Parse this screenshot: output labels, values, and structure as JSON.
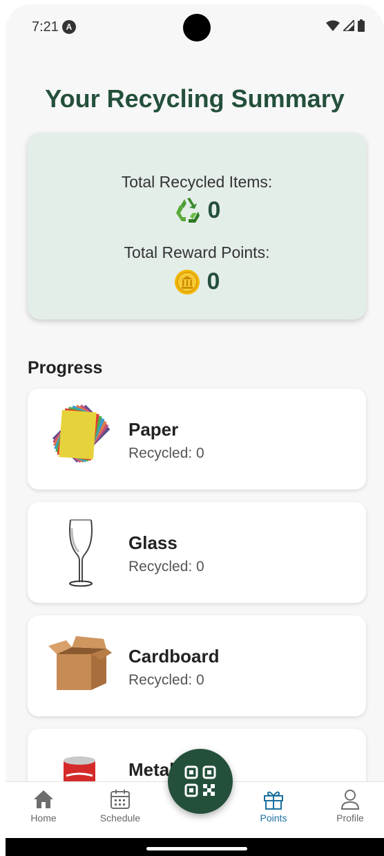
{
  "status_bar": {
    "time": "7:21",
    "notification_badge": "A"
  },
  "page": {
    "title": "Your Recycling Summary"
  },
  "summary": {
    "recycled_label": "Total Recycled Items:",
    "recycled_value": "0",
    "points_label": "Total Reward Points:",
    "points_value": "0"
  },
  "progress": {
    "title": "Progress",
    "items": [
      {
        "name": "Paper",
        "recycled": "Recycled: 0",
        "icon": "paper-stack-icon"
      },
      {
        "name": "Glass",
        "recycled": "Recycled: 0",
        "icon": "wine-glass-icon"
      },
      {
        "name": "Cardboard",
        "recycled": "Recycled: 0",
        "icon": "cardboard-box-icon"
      },
      {
        "name": "Metal",
        "icon": "soda-can-icon"
      }
    ]
  },
  "bottom_nav": {
    "items": [
      {
        "label": "Home",
        "icon": "home-icon"
      },
      {
        "label": "Schedule",
        "icon": "calendar-icon"
      },
      {
        "label": "Points",
        "icon": "gift-icon",
        "active": true
      },
      {
        "label": "Profile",
        "icon": "person-icon"
      }
    ],
    "fab_icon": "qr-code-icon"
  },
  "colors": {
    "brand_green": "#24503b",
    "summary_background": "#e4eee9",
    "nav_active": "#1a6f9e"
  }
}
